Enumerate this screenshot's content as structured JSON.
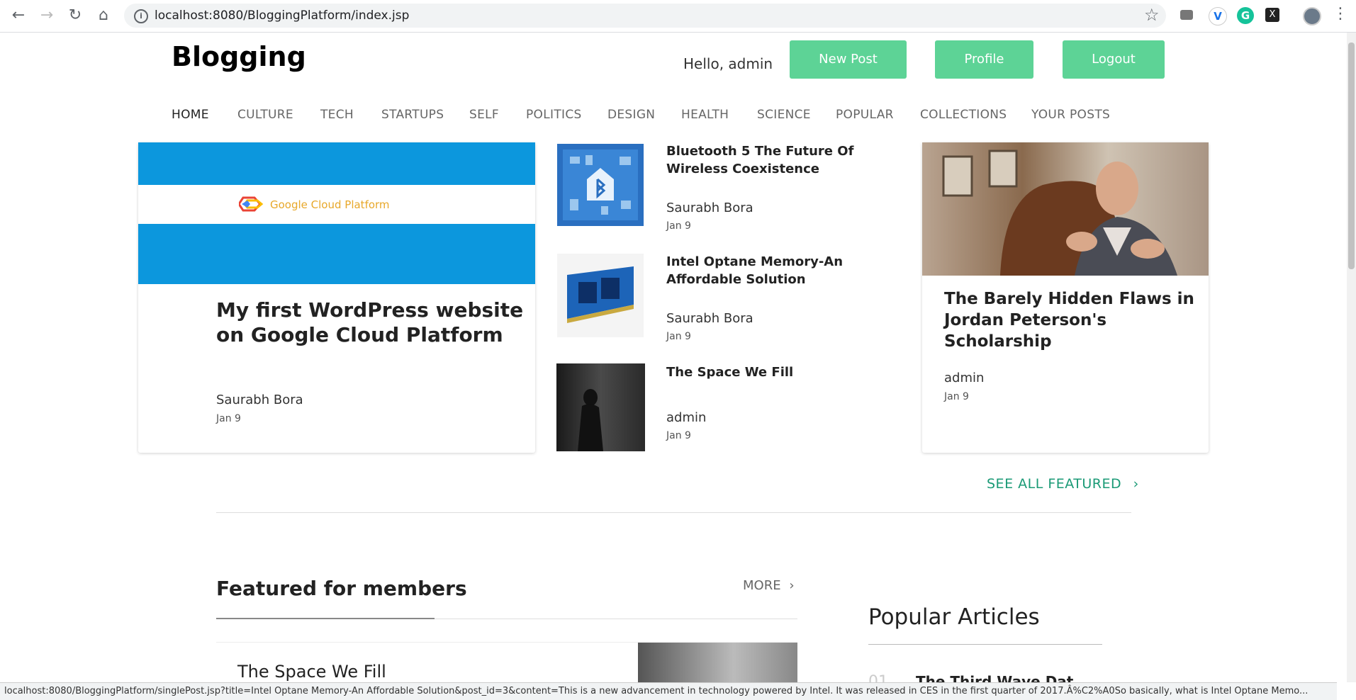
{
  "browser": {
    "url": "localhost:8080/BloggingPlatform/index.jsp",
    "status_url": "localhost:8080/BloggingPlatform/singlePost.jsp?title=Intel Optane Memory-An Affordable Solution&post_id=3&content=This is a new advancement in technology powered by Intel. It was released in CES in the first quarter of 2017.Â%C2%A0So basically, what is Intel Optane Memo..."
  },
  "header": {
    "site_title": "Blogging",
    "greeting": "Hello, admin",
    "new_post": "New Post",
    "profile": "Profile",
    "logout": "Logout"
  },
  "nav": [
    "HOME",
    "CULTURE",
    "TECH",
    "STARTUPS",
    "SELF",
    "POLITICS",
    "DESIGN",
    "HEALTH",
    "SCIENCE",
    "POPULAR",
    "COLLECTIONS",
    "YOUR POSTS"
  ],
  "featured": {
    "main": {
      "logo_text": "Google Cloud Platform",
      "title": "My first WordPress website on Google Cloud Platform",
      "author": "Saurabh Bora",
      "date": "Jan 9"
    },
    "list": [
      {
        "title": "Bluetooth 5 The Future Of Wireless Coexistence",
        "author": "Saurabh Bora",
        "date": "Jan 9"
      },
      {
        "title": "Intel Optane Memory-An Affordable Solution",
        "author": "Saurabh Bora",
        "date": "Jan 9"
      },
      {
        "title": "The Space We Fill",
        "author": "admin",
        "date": "Jan 9"
      }
    ],
    "right": {
      "title": "The Barely Hidden Flaws in Jordan Peterson's Scholarship",
      "author": "admin",
      "date": "Jan 9"
    },
    "see_all": "SEE ALL FEATURED"
  },
  "members": {
    "title": "Featured for members",
    "more": "MORE",
    "first_post_title": "The Space We Fill"
  },
  "popular": {
    "title": "Popular Articles",
    "first_item": "The Third Wave Dat..."
  },
  "colors": {
    "accent": "#5dd396",
    "link": "#1a9a76",
    "gcp_blue": "#0c97dd"
  }
}
